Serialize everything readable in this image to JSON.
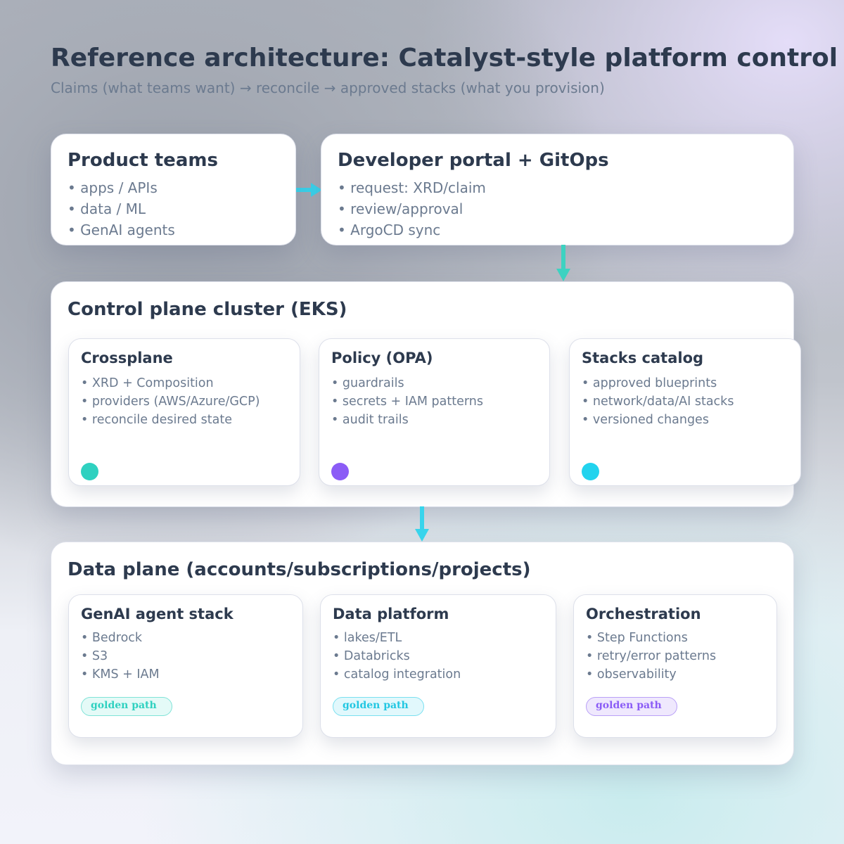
{
  "title": "Reference architecture: Catalyst-style platform control",
  "subtitle": "Claims (what teams want) → reconcile → approved stacks (what you provision)",
  "colors": {
    "teal": "#2fd1c0",
    "purple": "#8b5cf6",
    "cyan": "#22d3ee",
    "arrow_cyan": "#38d4ec",
    "arrow_teal": "#3dd2c1"
  },
  "product_teams": {
    "title": "Product teams",
    "items": [
      "• apps / APIs",
      "• data / ML",
      "• GenAI agents"
    ]
  },
  "dev_portal": {
    "title": "Developer portal + GitOps",
    "items": [
      "• request: XRD/claim",
      "• review/approval",
      "• ArgoCD sync"
    ]
  },
  "control_plane": {
    "title": "Control plane cluster (EKS)",
    "cards": [
      {
        "title": "Crossplane",
        "items": [
          "• XRD + Composition",
          "• providers (AWS/Azure/GCP)",
          "• reconcile desired state"
        ],
        "dot_color": "#2fd1c0"
      },
      {
        "title": "Policy (OPA)",
        "items": [
          "• guardrails",
          "• secrets + IAM patterns",
          "• audit trails"
        ],
        "dot_color": "#8b5cf6"
      },
      {
        "title": "Stacks catalog",
        "items": [
          "• approved blueprints",
          "• network/data/AI stacks",
          "• versioned changes"
        ],
        "dot_color": "#22d3ee"
      }
    ]
  },
  "data_plane": {
    "title": "Data plane (accounts/subscriptions/projects)",
    "cards": [
      {
        "title": "GenAI agent stack",
        "items": [
          "• Bedrock",
          "• S3",
          "• KMS + IAM"
        ],
        "badge": "golden path",
        "badge_color": "#2fd1c0"
      },
      {
        "title": "Data platform",
        "items": [
          "• lakes/ETL",
          "• Databricks",
          "• catalog integration"
        ],
        "badge": "golden path",
        "badge_color": "#22d3ee"
      },
      {
        "title": "Orchestration",
        "items": [
          "• Step Functions",
          "• retry/error patterns",
          "• observability"
        ],
        "badge": "golden path",
        "badge_color": "#8b5cf6"
      }
    ]
  }
}
